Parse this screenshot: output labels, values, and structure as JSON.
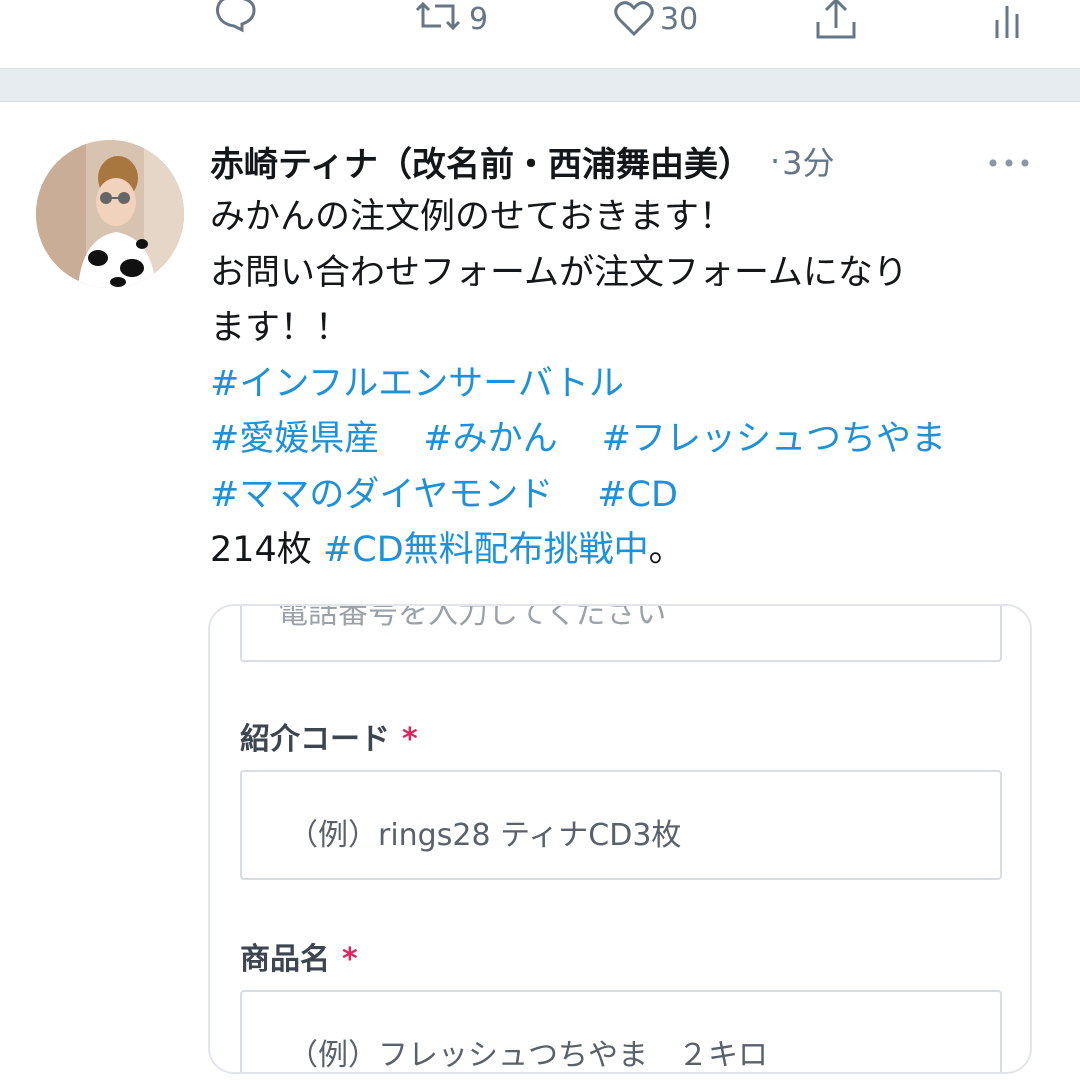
{
  "actions": {
    "retweet_count": "9",
    "like_count": "30"
  },
  "tweet": {
    "author_name": "赤崎ティナ（改名前・西浦舞由美）",
    "time_separator": "·",
    "time": "3分",
    "lines": [
      "みかんの注文例のせておきます！",
      "お問い合わせフォームが注文フォームになり",
      "ます！！"
    ],
    "hashtags": {
      "influencer_battle": "#インフルエンサーバトル",
      "ehime": "#愛媛県産",
      "mikan": "#みかん",
      "fresh_tsuchiyama": "#フレッシュつちやま",
      "mama_no_diamond": "#ママのダイヤモンド",
      "cd": "#CD",
      "cd_free": "#CD無料配布挑戦中"
    },
    "count_prefix": "214枚 ",
    "suffix": "。"
  },
  "embed_form": {
    "phone_placeholder": "電話番号を入力してください",
    "referral_label": "紹介コード",
    "referral_required": "*",
    "referral_placeholder": "（例）rings28 ティナCD3枚",
    "product_label": "商品名",
    "product_required": "*",
    "product_placeholder": "（例）フレッシュつちやま　２キロ"
  },
  "icons": {
    "reply": "reply-icon",
    "retweet": "retweet-icon",
    "like": "heart-icon",
    "share": "share-icon",
    "stats": "analytics-icon",
    "more": "more-icon"
  },
  "colors": {
    "text": "#14171a",
    "secondary": "#657786",
    "hashtag": "#1d91da",
    "separator": "#e6ecf0",
    "required": "#e0245e"
  }
}
